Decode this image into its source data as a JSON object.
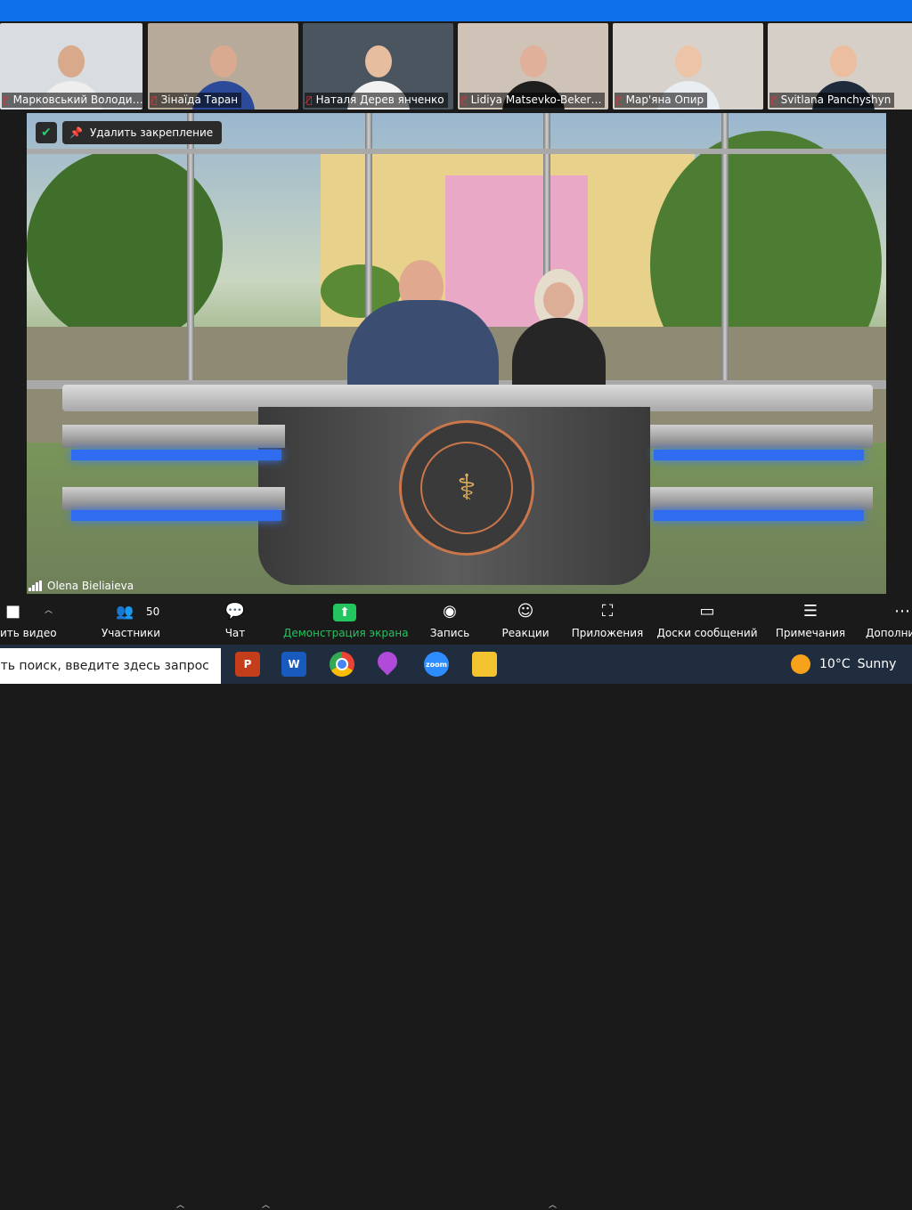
{
  "participants": [
    {
      "name": "Марковський Володи…",
      "bg": "#d9dde2",
      "skin": "#d8a98a",
      "shirt": "#eeeeee"
    },
    {
      "name": "Зінаїда Таран",
      "bg": "#b8aa9a",
      "skin": "#d9a990",
      "shirt": "#2c4a9a"
    },
    {
      "name": "Наталя Дерев янченко",
      "bg": "#4a5560",
      "skin": "#e7bda0",
      "shirt": "#f2f2f2"
    },
    {
      "name": "Lidiya Matsevko-Beker…",
      "bg": "#cfc3b8",
      "skin": "#e0b09a",
      "shirt": "#1e1e1e"
    },
    {
      "name": "Мар'яна Опир",
      "bg": "#d7d2cc",
      "skin": "#ecc4a8",
      "shirt": "#e9eef3"
    },
    {
      "name": "Svitlana Panchyshyn",
      "bg": "#d5cfc7",
      "skin": "#ebbea0",
      "shirt": "#1f2b3a"
    }
  ],
  "pin": {
    "unpin_label": "Удалить закрепление"
  },
  "speaker": {
    "name": "Olena Bieliaieva"
  },
  "toolbar": {
    "video_label": "ить видео",
    "participants_label": "Участники",
    "participants_count": "50",
    "chat_label": "Чат",
    "share_label": "Демонстрация экрана",
    "record_label": "Запись",
    "reactions_label": "Реакции",
    "apps_label": "Приложения",
    "whiteboards_label": "Доски сообщений",
    "notes_label": "Примечания",
    "more_label": "Дополни"
  },
  "taskbar": {
    "search_placeholder": "ать поиск, введите здесь запрос",
    "apps": [
      {
        "name": "powerpoint-icon",
        "glyph": "P",
        "color": "#c43e1c"
      },
      {
        "name": "word-icon",
        "glyph": "W",
        "color": "#185abd"
      },
      {
        "name": "chrome-icon",
        "glyph": "",
        "color": "#ffffff"
      },
      {
        "name": "paint-drop-icon",
        "glyph": "",
        "color": "#b04ad9"
      },
      {
        "name": "zoom-icon",
        "glyph": "zoom",
        "color": "#2d8cff"
      },
      {
        "name": "file-explorer-icon",
        "glyph": "",
        "color": "#f4c430"
      }
    ],
    "temperature": "10°C",
    "weather": "Sunny"
  },
  "colors": {
    "zoom_blue": "#0e71eb",
    "share_green": "#22c55e",
    "mic_off_red": "#e0343a"
  }
}
